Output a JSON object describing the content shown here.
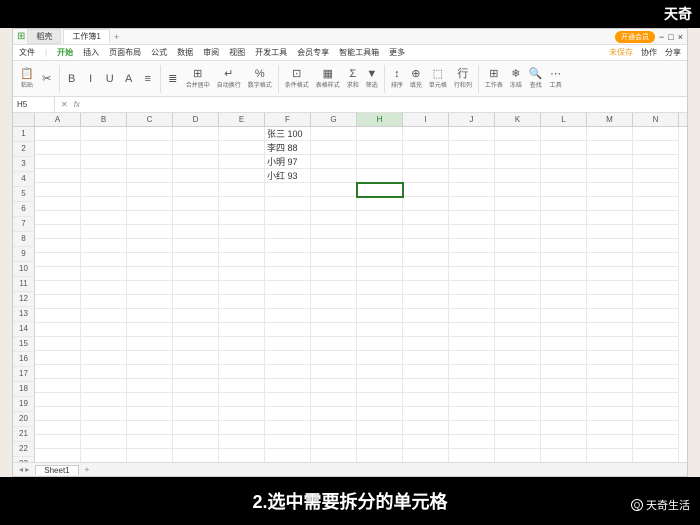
{
  "overlay": {
    "top_right": "天奇",
    "caption": "2.选中需要拆分的单元格",
    "watermark": "天奇生活"
  },
  "titlebar": {
    "tab1": "稻壳",
    "tab2": "工作簿1",
    "pill": "开通会员"
  },
  "menu": {
    "file": "文件",
    "items": [
      "开始",
      "插入",
      "页面布局",
      "公式",
      "数据",
      "审阅",
      "视图",
      "开发工具",
      "会员专享",
      "智能工具箱",
      "更多"
    ],
    "active_index": 0,
    "right": [
      "未保存",
      "协作",
      "分享"
    ]
  },
  "ribbon": {
    "groups": [
      {
        "ico": "📋",
        "label": "粘贴"
      },
      {
        "ico": "✂",
        "label": ""
      },
      {
        "ico": "B",
        "label": ""
      },
      {
        "ico": "I",
        "label": ""
      },
      {
        "ico": "U",
        "label": ""
      },
      {
        "ico": "A",
        "label": ""
      },
      {
        "ico": "≡",
        "label": ""
      },
      {
        "ico": "≣",
        "label": ""
      },
      {
        "ico": "⊞",
        "label": "合并居中"
      },
      {
        "ico": "↵",
        "label": "自动换行"
      },
      {
        "ico": "%",
        "label": "数字格式"
      },
      {
        "ico": "⊡",
        "label": "条件格式"
      },
      {
        "ico": "▦",
        "label": "表格样式"
      },
      {
        "ico": "Σ",
        "label": "求和"
      },
      {
        "ico": "▼",
        "label": "筛选"
      },
      {
        "ico": "↕",
        "label": "排序"
      },
      {
        "ico": "⊕",
        "label": "填充"
      },
      {
        "ico": "⬚",
        "label": "单元格"
      },
      {
        "ico": "行",
        "label": "行和列"
      },
      {
        "ico": "⊞",
        "label": "工作表"
      },
      {
        "ico": "❄",
        "label": "冻结"
      },
      {
        "ico": "🔍",
        "label": "查找"
      },
      {
        "ico": "⋯",
        "label": "工具"
      }
    ]
  },
  "namebox": {
    "ref": "H5",
    "fx": "fx"
  },
  "columns": [
    "A",
    "B",
    "C",
    "D",
    "E",
    "F",
    "G",
    "H",
    "I",
    "J",
    "K",
    "L",
    "M",
    "N"
  ],
  "selected_col_index": 7,
  "selected_cell": {
    "row": 5,
    "col": 7
  },
  "data_cells": {
    "F1": "张三 100",
    "F2": "李四 88",
    "F3": "小明 97",
    "F4": "小红 93"
  },
  "row_count": 24,
  "sheet": {
    "name": "Sheet1"
  }
}
